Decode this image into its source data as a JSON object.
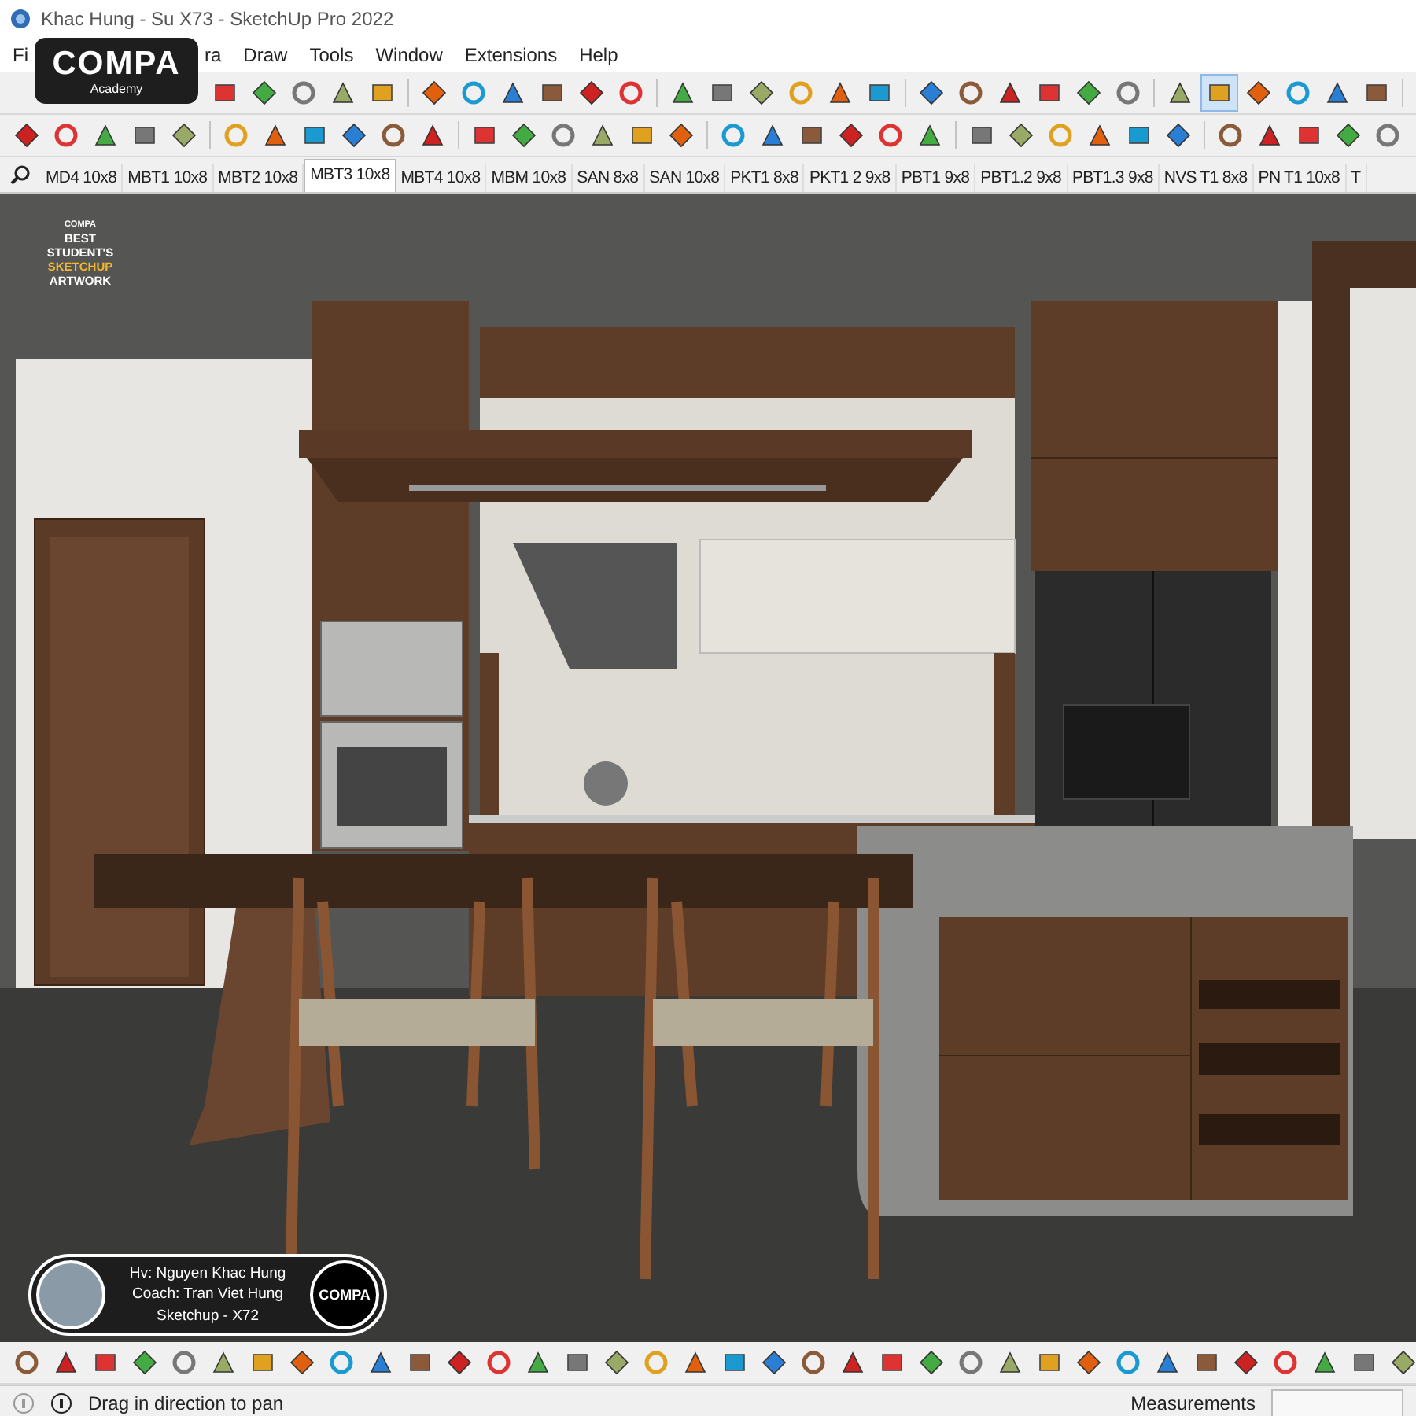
{
  "window": {
    "title": "Khac Hung - Su X73 - SketchUp Pro 2022"
  },
  "menu": {
    "items": [
      "Fi",
      "ra",
      "Draw",
      "Tools",
      "Window",
      "Extensions",
      "Help"
    ]
  },
  "overlay_logo": {
    "name": "COMPA",
    "subtitle": "Academy"
  },
  "scene_tabs": [
    {
      "label": "MD4 10x8",
      "selected": false
    },
    {
      "label": "MBT1 10x8",
      "selected": false
    },
    {
      "label": "MBT2 10x8",
      "selected": false
    },
    {
      "label": "MBT3 10x8",
      "selected": true
    },
    {
      "label": "MBT4 10x8",
      "selected": false
    },
    {
      "label": "MBM 10x8",
      "selected": false
    },
    {
      "label": "SAN 8x8",
      "selected": false
    },
    {
      "label": "SAN 10x8",
      "selected": false
    },
    {
      "label": "PKT1 8x8",
      "selected": false
    },
    {
      "label": "PKT1 2 9x8",
      "selected": false
    },
    {
      "label": "PBT1 9x8",
      "selected": false
    },
    {
      "label": "PBT1.2 9x8",
      "selected": false
    },
    {
      "label": "PBT1.3 9x8",
      "selected": false
    },
    {
      "label": "NVS T1 8x8",
      "selected": false
    },
    {
      "label": "PN T1 10x8",
      "selected": false
    },
    {
      "label": "T",
      "selected": false
    }
  ],
  "viewport": {
    "award_badge": {
      "brand": "COMPA",
      "lines": [
        "BEST",
        "STUDENT'S",
        "SKETCHUP",
        "ARTWORK"
      ]
    },
    "student_card": {
      "lines": [
        "Hv: Nguyen Khac Hung",
        "Coach: Tran Viet Hung",
        "Sketchup - X72"
      ],
      "logo": "COMPA"
    }
  },
  "status_bar": {
    "hint": "Drag in direction to pan",
    "measurements_label": "Measurements"
  }
}
